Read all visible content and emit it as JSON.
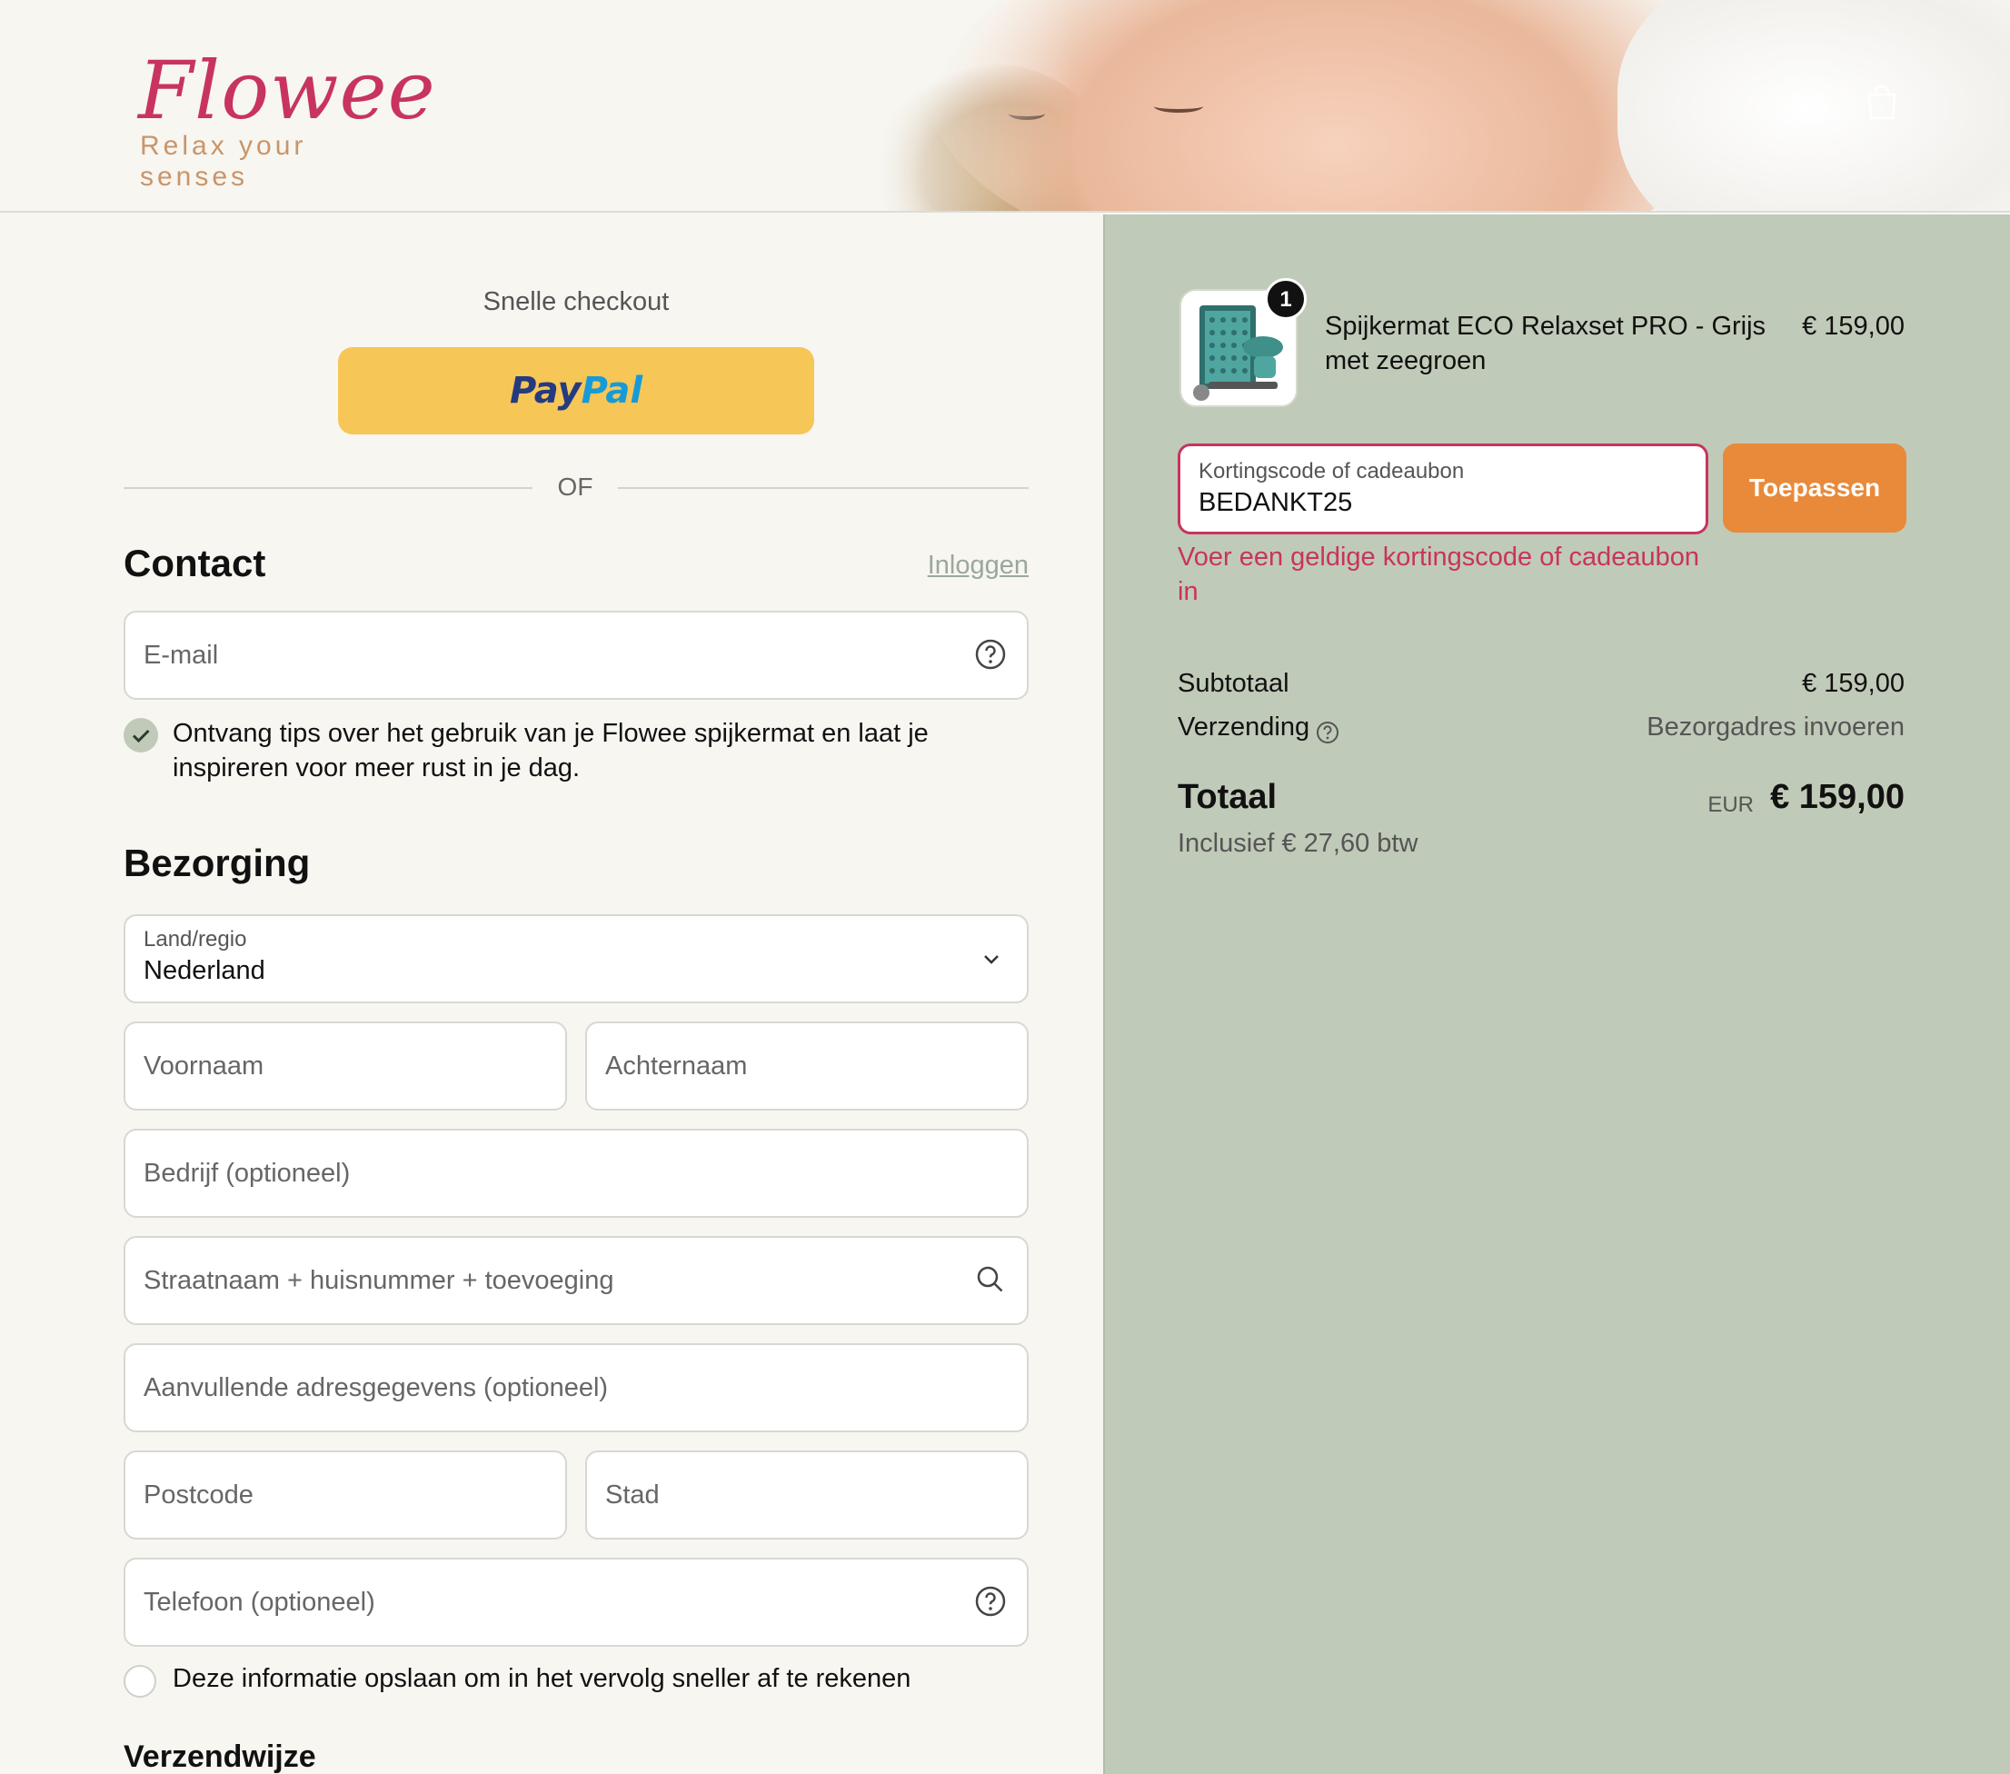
{
  "brand": {
    "name": "Flowee",
    "tagline": "Relax your senses"
  },
  "checkout": {
    "quick_checkout_title": "Snelle checkout",
    "paypal_pay": "Pay",
    "paypal_pal": "Pal",
    "or_text": "OF"
  },
  "contact": {
    "heading": "Contact",
    "login_link": "Inloggen",
    "email_placeholder": "E-mail",
    "newsletter_checked": true,
    "newsletter_text": "Ontvang tips over het gebruik van je Flowee spijkermat en laat je inspireren voor meer rust in je dag."
  },
  "delivery": {
    "heading": "Bezorging",
    "country_label": "Land/regio",
    "country_value": "Nederland",
    "first_name_placeholder": "Voornaam",
    "last_name_placeholder": "Achternaam",
    "company_placeholder": "Bedrijf (optioneel)",
    "street_placeholder": "Straatnaam + huisnummer + toevoeging",
    "address2_placeholder": "Aanvullende adresgegevens (optioneel)",
    "postcode_placeholder": "Postcode",
    "city_placeholder": "Stad",
    "phone_placeholder": "Telefoon (optioneel)",
    "save_info_checked": false,
    "save_info_text": "Deze informatie opslaan om in het vervolg sneller af te rekenen"
  },
  "shipping_method": {
    "heading": "Verzendwijze"
  },
  "summary": {
    "product": {
      "quantity": "1",
      "name": "Spijkermat ECO Relaxset PRO - Grijs met zeegroen",
      "price": "€ 159,00"
    },
    "discount": {
      "label": "Kortingscode of cadeaubon",
      "value": "BEDANKT25",
      "apply_label": "Toepassen",
      "error": "Voer een geldige kortingscode of cadeaubon in"
    },
    "subtotal_label": "Subtotaal",
    "subtotal_value": "€ 159,00",
    "shipping_label": "Verzending",
    "shipping_value": "Bezorgadres invoeren",
    "total_label": "Totaal",
    "total_currency": "EUR",
    "total_value": "€ 159,00",
    "tax_note": "Inclusief € 27,60 btw"
  },
  "colors": {
    "brand_pink": "#c8345e",
    "summary_bg": "#c0cab8",
    "apply_orange": "#e88a3a",
    "paypal_yellow": "#f6c657"
  },
  "icons": {
    "cart": "shopping-bag-icon",
    "help": "question-circle-icon",
    "search": "search-icon",
    "chevron": "chevron-down-icon",
    "check": "check-icon"
  }
}
